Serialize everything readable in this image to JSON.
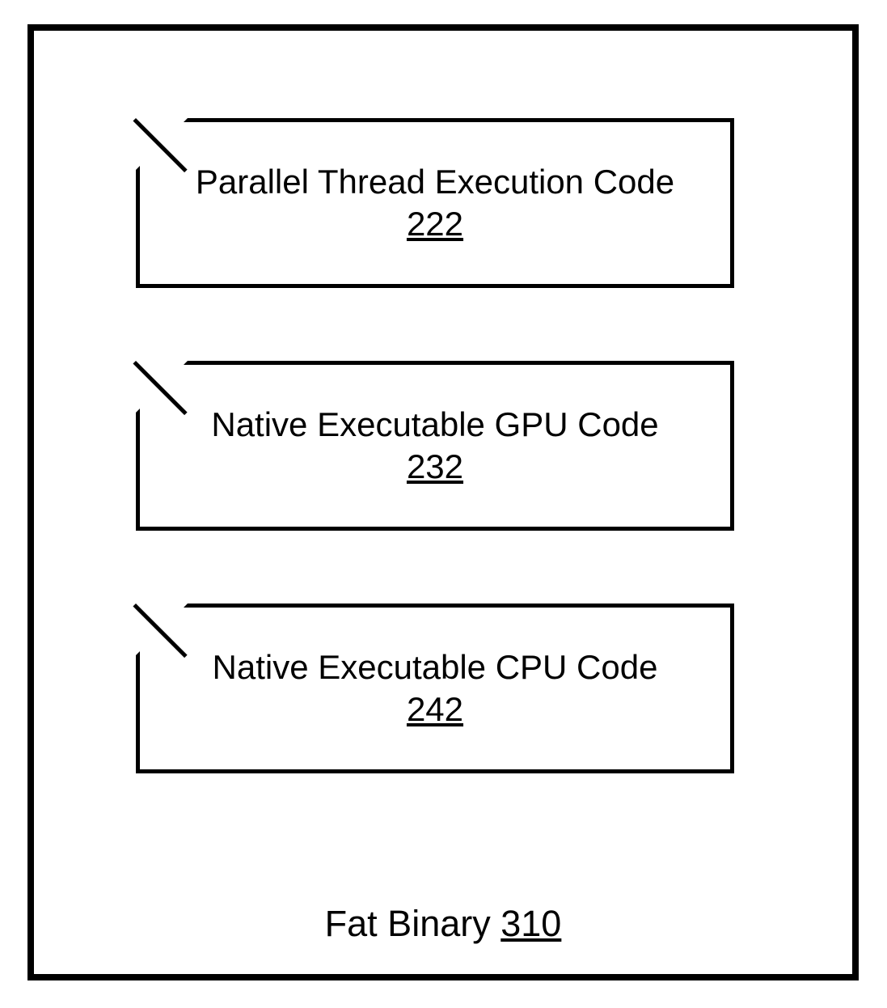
{
  "container": {
    "label": "Fat Binary",
    "ref": "310"
  },
  "blocks": [
    {
      "title": "Parallel Thread Execution Code",
      "ref": "222"
    },
    {
      "title": "Native Executable GPU Code",
      "ref": "232"
    },
    {
      "title": "Native Executable CPU Code",
      "ref": "242"
    }
  ]
}
